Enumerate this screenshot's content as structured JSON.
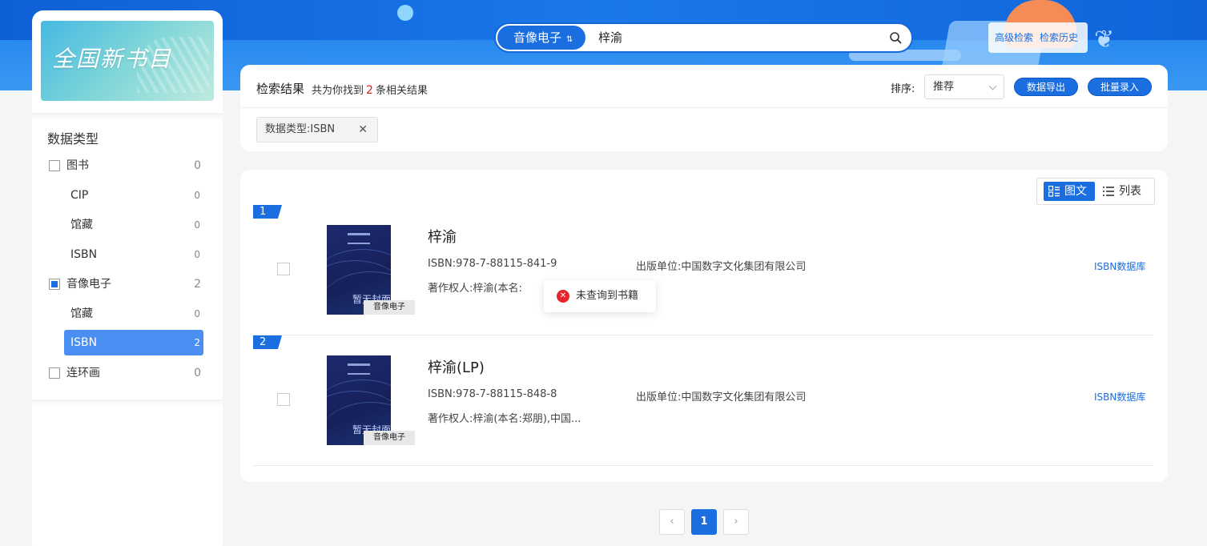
{
  "search": {
    "type_label": "音像电子",
    "swap_glyph": "⇅",
    "query": "梓渝",
    "advanced": "高级检索",
    "history": "检索历史"
  },
  "sidebar": {
    "logo_text": "全国新书目",
    "title": "数据类型",
    "groups": [
      {
        "label": "图书",
        "count": "0",
        "checked": false,
        "subs": [
          {
            "label": "CIP",
            "count": "0"
          },
          {
            "label": "馆藏",
            "count": "0"
          },
          {
            "label": "ISBN",
            "count": "0"
          }
        ]
      },
      {
        "label": "音像电子",
        "count": "2",
        "checked": true,
        "subs": [
          {
            "label": "馆藏",
            "count": "0"
          },
          {
            "label": "ISBN",
            "count": "2",
            "active": true
          }
        ]
      },
      {
        "label": "连环画",
        "count": "0",
        "checked": false,
        "subs": []
      }
    ]
  },
  "results_header": {
    "title": "检索结果",
    "summary_prefix": "共为你找到",
    "count": "2",
    "summary_suffix": "条相关结果",
    "sort_label": "排序:",
    "sort_value": "推荐",
    "export_label": "数据导出",
    "batch_label": "批量录入",
    "filter_tag": "数据类型:ISBN",
    "close_glyph": "✕"
  },
  "view_toggle": {
    "grid": "图文",
    "list": "列表"
  },
  "items": [
    {
      "index": "1",
      "title": "梓渝",
      "isbn": "ISBN:978-7-88115-841-9",
      "publisher": "出版单位:中国数字文化集团有限公司",
      "author": "著作权人:梓渝(本名:",
      "cover_text": "暂无封面",
      "cover_tag": "音像电子",
      "link": "ISBN数据库"
    },
    {
      "index": "2",
      "title": "梓渝(LP)",
      "isbn": "ISBN:978-7-88115-848-8",
      "publisher": "出版单位:中国数字文化集团有限公司",
      "author": "著作权人:梓渝(本名:郑朋),中国...",
      "cover_text": "暂无封面",
      "cover_tag": "音像电子",
      "link": "ISBN数据库"
    }
  ],
  "toast": {
    "message": "未查询到书籍",
    "icon_glyph": "✕"
  },
  "pagination": {
    "prev": "‹",
    "current": "1",
    "next": "›"
  },
  "colors": {
    "primary": "#1a6ee0",
    "accent_red": "#e02020",
    "error": "#e5252d"
  }
}
